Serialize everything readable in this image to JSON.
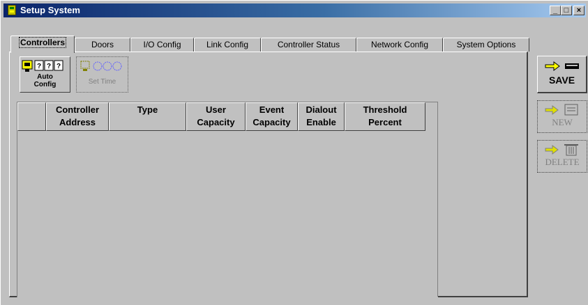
{
  "window": {
    "title": "Setup System",
    "title_icon": "app-icon",
    "controls": {
      "minimize": "_",
      "maximize": "□",
      "close": "×"
    }
  },
  "tabs": [
    {
      "label": "Controllers",
      "active": true
    },
    {
      "label": "Doors"
    },
    {
      "label": "I/O Config"
    },
    {
      "label": "Link Config"
    },
    {
      "label": "Controller Status"
    },
    {
      "label": "Network Config"
    },
    {
      "label": "System Options"
    }
  ],
  "toolbar": {
    "auto_config": {
      "line1": "Auto",
      "line2": "Config",
      "icon": "auto-config-icon"
    },
    "set_time": {
      "label": "Set Time",
      "icon": "set-time-icon",
      "enabled": false
    }
  },
  "grid": {
    "columns": [
      "",
      "Controller\nAddress",
      "Type",
      "User\nCapacity",
      "Event\nCapacity",
      "Dialout\nEnable",
      "Threshold\nPercent"
    ],
    "rows": []
  },
  "side_buttons": {
    "save": {
      "label": "SAVE",
      "icon": "save-icon",
      "enabled": true
    },
    "new": {
      "label": "NEW",
      "icon": "new-icon",
      "enabled": false
    },
    "delete": {
      "label": "DELETE",
      "icon": "delete-icon",
      "enabled": false
    }
  },
  "colors": {
    "titlebar_start": "#0a246a",
    "titlebar_end": "#a6caf0",
    "face": "#c0c0c0",
    "arrow_yellow": "#ffff00"
  }
}
